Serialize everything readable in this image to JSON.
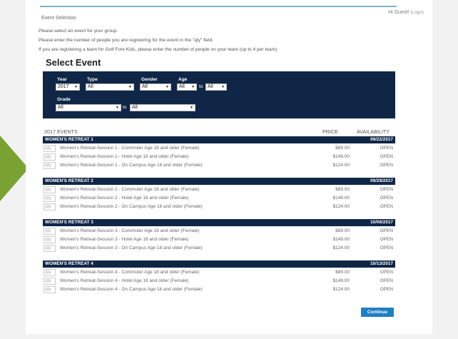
{
  "header": {
    "greeting": "Hi Guest!",
    "login": "(Login)",
    "breadcrumb": "Event Selection"
  },
  "instructions": [
    "Please select an event for your group.",
    "Please enter the number of people you are registering for the event in the \"qty\" field.",
    "If you are registering a team for Golf Fore Kids, please enter the number of people on your team (up to 4 per team)"
  ],
  "title": "Select Event",
  "filters": {
    "year_label": "Year",
    "year_value": "2017",
    "type_label": "Type",
    "type_value": "All",
    "gender_label": "Gender",
    "gender_value": "All",
    "age_label": "Age",
    "age_from": "All",
    "age_to_word": "to",
    "age_to": "All",
    "grade_label": "Grade",
    "grade_from": "All",
    "grade_to_word": "to",
    "grade_to": "All"
  },
  "columns": {
    "events": "2017 EVENTS",
    "price": "PRICE",
    "availability": "AVAILABILITY"
  },
  "qty_placeholder": "qty",
  "groups": [
    {
      "name": "WOMEN'S RETREAT 1",
      "date": "09/22/2017",
      "rows": [
        {
          "name": "Women's Retreat-Session 1 - Commuter Age 18 and older (Female)",
          "price": "$89.00",
          "avail": "OPEN"
        },
        {
          "name": "Women's Retreat-Session 1 - Hotel Age 18 and older (Female)",
          "price": "$149.00",
          "avail": "OPEN"
        },
        {
          "name": "Women's Retreat-Session 1 - On Campus Age 18 and older (Female)",
          "price": "$124.00",
          "avail": "OPEN"
        }
      ]
    },
    {
      "name": "WOMEN'S RETREAT 2",
      "date": "09/29/2017",
      "rows": [
        {
          "name": "Women's Retreat-Session 2 - Commuter Age 18 and older (Female)",
          "price": "$89.00",
          "avail": "OPEN"
        },
        {
          "name": "Women's Retreat-Session 2 - Hotel Age 18 and older (Female)",
          "price": "$149.00",
          "avail": "OPEN"
        },
        {
          "name": "Women's Retreat-Session 2 - On Campus Age 18 and older (Female)",
          "price": "$124.00",
          "avail": "OPEN"
        }
      ]
    },
    {
      "name": "WOMEN'S RETREAT 3",
      "date": "10/06/2017",
      "rows": [
        {
          "name": "Women's Retreat-Session 3 - Commuter Age 18 and older (Female)",
          "price": "$89.00",
          "avail": "OPEN"
        },
        {
          "name": "Women's Retreat-Session 3 - Hotel Age 18 and older (Female)",
          "price": "$149.00",
          "avail": "OPEN"
        },
        {
          "name": "Women's Retreat-Session 3 - On Campus Age 18 and older (Female)",
          "price": "$124.00",
          "avail": "OPEN"
        }
      ]
    },
    {
      "name": "WOMEN'S RETREAT 4",
      "date": "10/13/2017",
      "rows": [
        {
          "name": "Women's Retreat-Session 4 - Commuter Age 18 and older (Female)",
          "price": "$89.00",
          "avail": "OPEN"
        },
        {
          "name": "Women's Retreat-Session 4 - Hotel Age 18 and older (Female)",
          "price": "$149.00",
          "avail": "OPEN"
        },
        {
          "name": "Women's Retreat-Session 4 - On Campus Age 18 and older (Female)",
          "price": "$124.00",
          "avail": "OPEN"
        }
      ]
    }
  ],
  "continue_label": "Continue",
  "colors": {
    "navy": "#0f2647",
    "button": "#1f7fc4",
    "arrow": "#7aa233"
  }
}
